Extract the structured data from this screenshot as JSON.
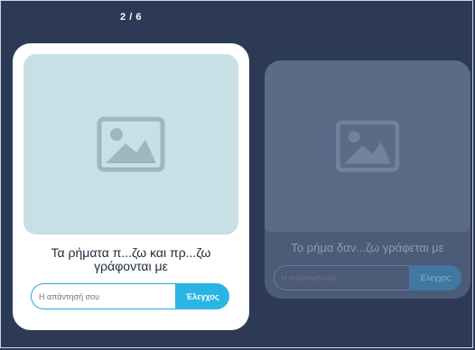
{
  "progress": {
    "counter": "2 / 6"
  },
  "cards": [
    {
      "prompt": "Τα ρήματα π...ζω και πρ...ζω γράφονται με",
      "answer_placeholder": "Η απάντησή σου",
      "answer_value": "",
      "check_label": "Έλεγχος"
    },
    {
      "prompt": "Το ρήμα δαν...ζω γράφεται με",
      "answer_placeholder": "Η απάντησή σου",
      "check_label": "Έλεγχος"
    }
  ],
  "icons": {
    "placeholder_image": "image-placeholder-icon"
  },
  "colors": {
    "background": "#2c3a55",
    "accent": "#2ab4e4",
    "image_bg": "#c8e0e5"
  }
}
